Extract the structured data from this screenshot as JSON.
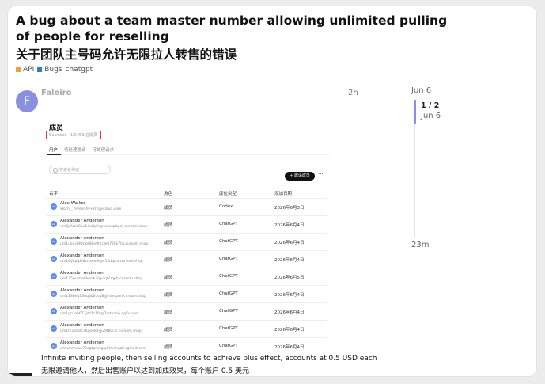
{
  "topic": {
    "title_en": "A bug about a team master number allowing unlimited pulling of people for reselling",
    "title_zh": "关于团队主号码允许无限拉人转售的错误",
    "tags": [
      {
        "label": "API",
        "color": "#e8a33d"
      },
      {
        "label": "Bugs",
        "color": "#2f7fc1"
      },
      {
        "label": "chatgpt",
        "color": ""
      }
    ]
  },
  "post": {
    "avatar_letter": "F",
    "avatar_color": "#8a8fe0",
    "username": "Faleiro",
    "time": "2h",
    "body_en": "Infinite inviting people, then selling accounts to achieve plus effect, accounts at 0.5 USD each",
    "body_zh": "无限邀请他人，然后出售账户以达到加成效果，每个账户 0.5 美元"
  },
  "screenshot": {
    "heading": "成员",
    "subheading": "Business · 1/0453 位成员",
    "tabs": [
      "用户",
      "待处理邀请",
      "待处理请求"
    ],
    "search_placeholder": "搜索名称或",
    "invite_label": "+ 邀请成员",
    "more": "···",
    "columns": [
      "名字",
      "角色",
      "席位类型",
      "添加日期"
    ],
    "rows": [
      {
        "initials": "AW",
        "name": "Alex Walker",
        "email": "xlochi_.mvilen4v+zrb@icloud.com",
        "role": "成员",
        "seat": "Codex",
        "date": "2026年6月3日"
      },
      {
        "initials": "AA",
        "name": "Alexander Anderson",
        "email": "um5jrfezeGsu14utqifc@wxwxpbpm.cursom.shop",
        "role": "成员",
        "seat": "ChatGPT",
        "date": "2026年6月4日"
      },
      {
        "initials": "AA",
        "name": "Alexander Anderson",
        "email": "um1ukuyhhtx2e88e9mc@072kk7hy.cursom.shop",
        "role": "成员",
        "seat": "ChatGPT",
        "date": "2026年6月4日"
      },
      {
        "initials": "AA",
        "name": "Alexander Anderson",
        "email": "um16y8pg2i8zcpwe0i@v1fkbpcv.cursom.shop",
        "role": "成员",
        "seat": "ChatGPT",
        "date": "2026年6月4日"
      },
      {
        "initials": "AA",
        "name": "Alexander Anderson",
        "email": "um135guvtjei9wc9v6@dqbizqpb.cursom.shop",
        "role": "成员",
        "seat": "ChatGPT",
        "date": "2026年6月5日"
      },
      {
        "initials": "AA",
        "name": "Alexander Anderson",
        "email": "um118hhq13uq5b0usg8@rstvtpmf.cursom.shop",
        "role": "成员",
        "seat": "ChatGPT",
        "date": "2026年6月4日"
      },
      {
        "initials": "AA",
        "name": "Alexander Anderson",
        "email": "um1pcuob673jdz1c1fs@7mthrbxi.cgifu.com",
        "role": "成员",
        "seat": "ChatGPT",
        "date": "2026年6月4日"
      },
      {
        "initials": "AA",
        "name": "Alexander Anderson",
        "email": "um1fn10cslc76pee84@29f80csr.cursom.shop",
        "role": "成员",
        "seat": "ChatGPT",
        "date": "2026年6月4日"
      },
      {
        "initials": "AA",
        "name": "Alexander Anderson",
        "email": "umlwhmcwa70egtpnafg@0k5dhgzlr.cgifu.it.com",
        "role": "成员",
        "seat": "ChatGPT",
        "date": "2026年6月4日"
      }
    ]
  },
  "timeline": {
    "start_date": "Jun 6",
    "position": "1 / 2",
    "current_date": "Jun 6",
    "age": "23m",
    "accent": "#8a8fe0"
  }
}
